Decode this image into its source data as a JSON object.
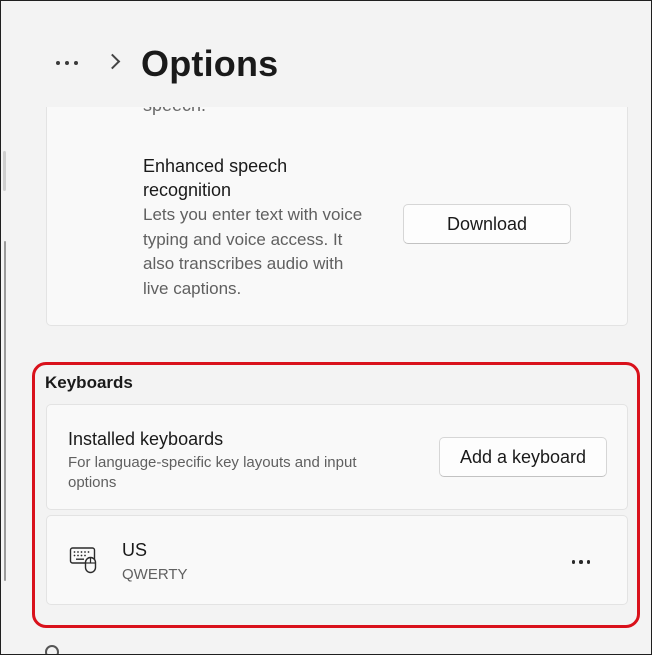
{
  "header": {
    "more_icon": "ellipsis-icon",
    "chevron_icon": "chevron-right-icon",
    "title": "Options"
  },
  "speech": {
    "partial_text": "speech.",
    "title": "Enhanced speech recognition",
    "description": "Lets you enter text with voice typing and voice access. It also transcribes audio with live captions.",
    "download_label": "Download"
  },
  "keyboards": {
    "section_label": "Keyboards",
    "installed": {
      "title": "Installed keyboards",
      "description": "For language-specific key layouts and input options",
      "add_label": "Add a keyboard"
    },
    "items": [
      {
        "icon": "keyboard-icon",
        "name": "US",
        "layout": "QWERTY",
        "more_icon": "ellipsis-icon"
      }
    ]
  },
  "colors": {
    "highlight": "#d9111b",
    "background": "#f3f3f3",
    "card": "#f9f9f9"
  }
}
